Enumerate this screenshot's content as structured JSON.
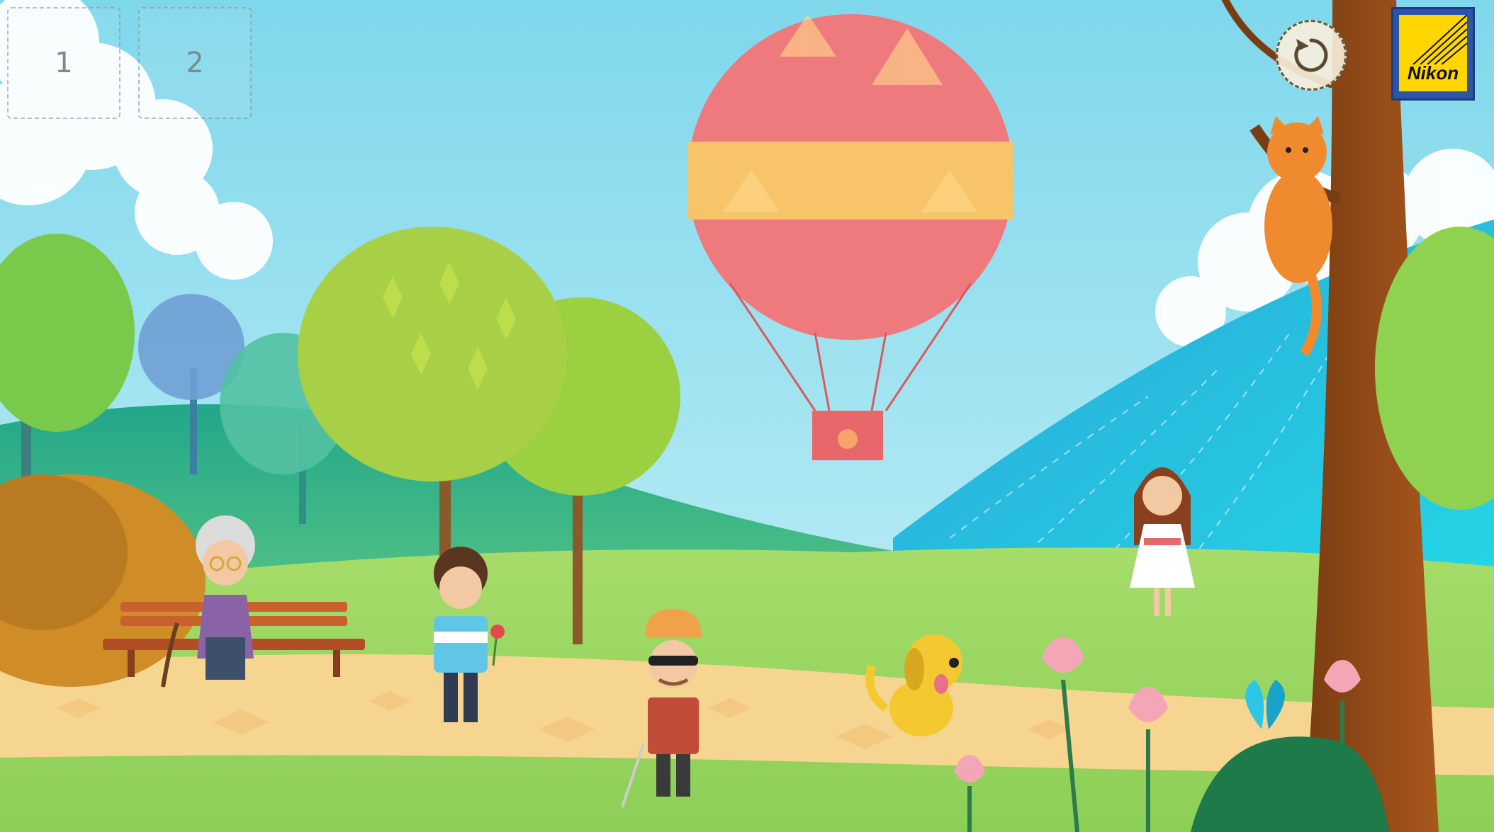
{
  "slots": [
    {
      "label": "1"
    },
    {
      "label": "2"
    }
  ],
  "reset_button": {
    "icon": "reset-arrow-icon"
  },
  "brand_badge": {
    "text": "Nikon",
    "colors": {
      "outer": "#2b56a6",
      "inner": "#ffd600"
    }
  },
  "scene": {
    "sky_color": "#9fe4f0",
    "hill_colors": [
      "#2fb58c",
      "#23c9dc",
      "#8fd56a"
    ],
    "path_color": "#f6d591",
    "balloon_colors": [
      "#ef7a7e",
      "#f7c46a"
    ]
  }
}
